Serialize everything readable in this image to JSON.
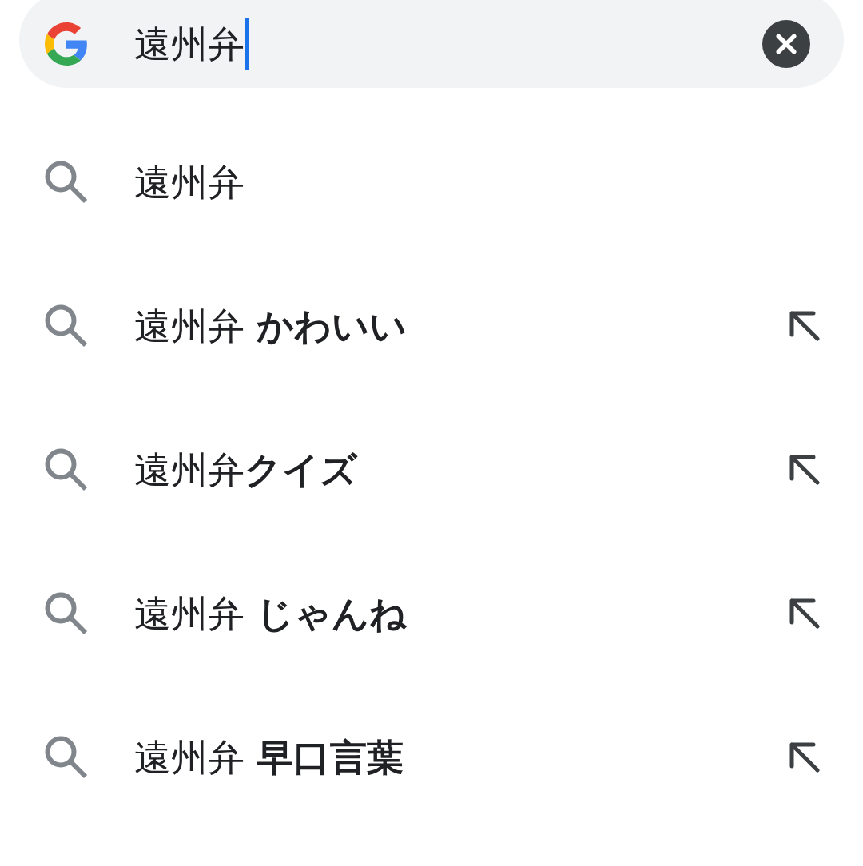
{
  "search": {
    "query": "遠州弁",
    "focused": true
  },
  "suggestions": [
    {
      "kind": "current",
      "text": "遠州弁"
    },
    {
      "kind": "completion",
      "text": "遠州弁 **かわいい**"
    },
    {
      "kind": "completion",
      "text": "遠州弁**クイズ**"
    },
    {
      "kind": "completion",
      "text": "遠州弁 **じゃんね**"
    },
    {
      "kind": "completion",
      "text": "遠州弁 **早口言葉**"
    }
  ]
}
